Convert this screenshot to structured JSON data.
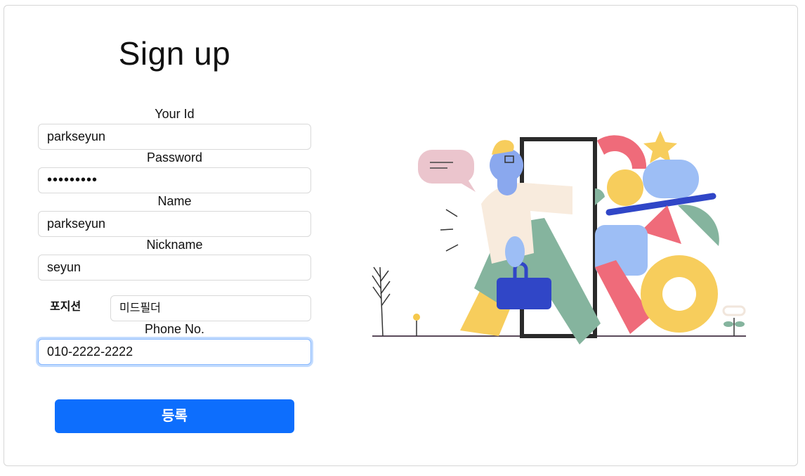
{
  "form": {
    "title": "Sign up",
    "id_label": "Your Id",
    "id_value": "parkseyun",
    "password_label": "Password",
    "password_value": "•••••••••",
    "name_label": "Name",
    "name_value": "parkseyun",
    "nickname_label": "Nickname",
    "nickname_value": "seyun",
    "position_label": "포지션",
    "position_value": "미드필더",
    "phone_label": "Phone No.",
    "phone_value": "010-2222-2222",
    "submit_label": "등록"
  },
  "colors": {
    "accent": "#0d6efd",
    "focus_ring": "#86b7fe"
  }
}
